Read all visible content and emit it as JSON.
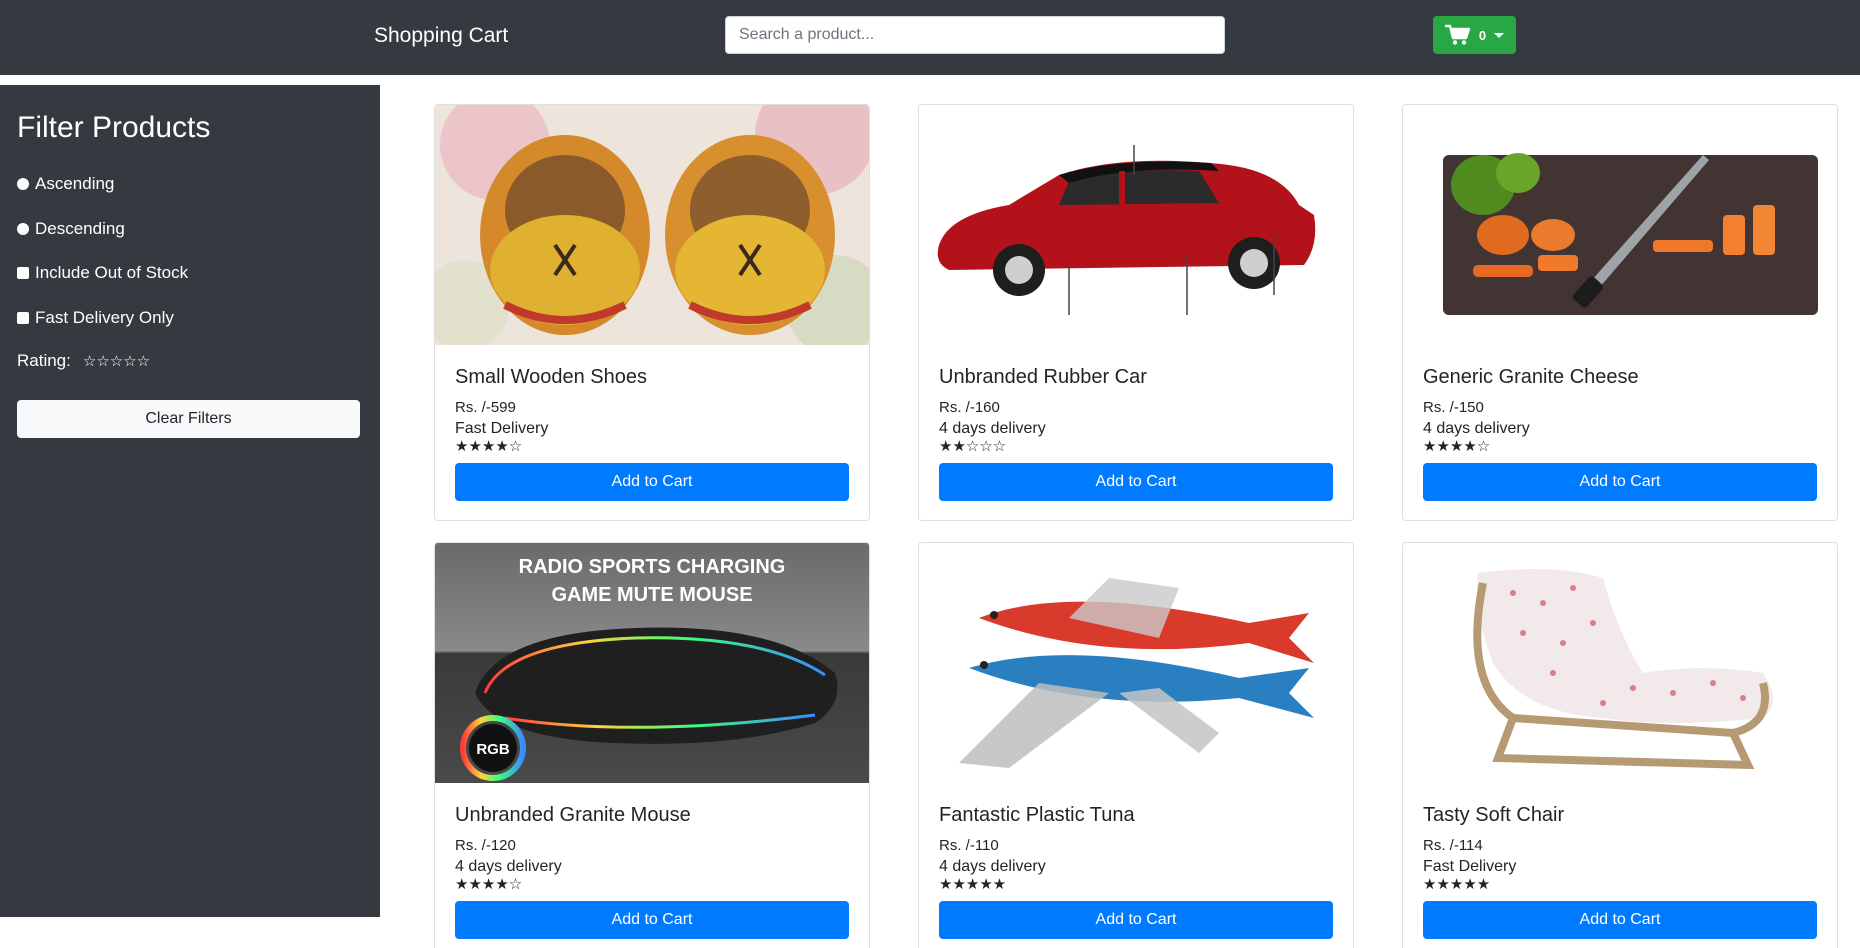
{
  "navbar": {
    "brand": "Shopping Cart",
    "search_placeholder": "Search a product...",
    "cart_count": "0",
    "cart_button_color": "#28a745"
  },
  "sidebar": {
    "title": "Filter Products",
    "ascending_label": "Ascending",
    "descending_label": "Descending",
    "out_of_stock_label": "Include Out of Stock",
    "fast_delivery_label": "Fast Delivery Only",
    "rating_label": "Rating:",
    "rating_stars": "☆☆☆☆☆",
    "clear_label": "Clear Filters"
  },
  "products": [
    {
      "name": "Small Wooden Shoes",
      "price": "Rs. /-599",
      "delivery": "Fast Delivery",
      "rating": 4,
      "stars": "★★★★☆",
      "button": "Add to Cart",
      "image": "wooden-shoes"
    },
    {
      "name": "Unbranded Rubber Car",
      "price": "Rs. /-160",
      "delivery": "4 days delivery",
      "rating": 2,
      "stars": "★★☆☆☆",
      "button": "Add to Cart",
      "image": "red-toy-car"
    },
    {
      "name": "Generic Granite Cheese",
      "price": "Rs. /-150",
      "delivery": "4 days delivery",
      "rating": 4,
      "stars": "★★★★☆",
      "button": "Add to Cart",
      "image": "vegetables-on-board"
    },
    {
      "name": "Unbranded Granite Mouse",
      "price": "Rs. /-120",
      "delivery": "4 days delivery",
      "rating": 4,
      "stars": "★★★★☆",
      "button": "Add to Cart",
      "image": "rgb-gaming-mouse"
    },
    {
      "name": "Fantastic Plastic Tuna",
      "price": "Rs. /-110",
      "delivery": "4 days delivery",
      "rating": 5,
      "stars": "★★★★★",
      "button": "Add to Cart",
      "image": "flying-fish"
    },
    {
      "name": "Tasty Soft Chair",
      "price": "Rs. /-114",
      "delivery": "Fast Delivery",
      "rating": 5,
      "stars": "★★★★★",
      "button": "Add to Cart",
      "image": "lounge-chair"
    }
  ],
  "images": {
    "mouse_banner_line1": "RADIO SPORTS CHARGING",
    "mouse_banner_line2": "GAME MUTE MOUSE",
    "mouse_badge": "RGB"
  },
  "colors": {
    "navbar_bg": "#343a40",
    "primary": "#007bff",
    "success": "#28a745"
  }
}
